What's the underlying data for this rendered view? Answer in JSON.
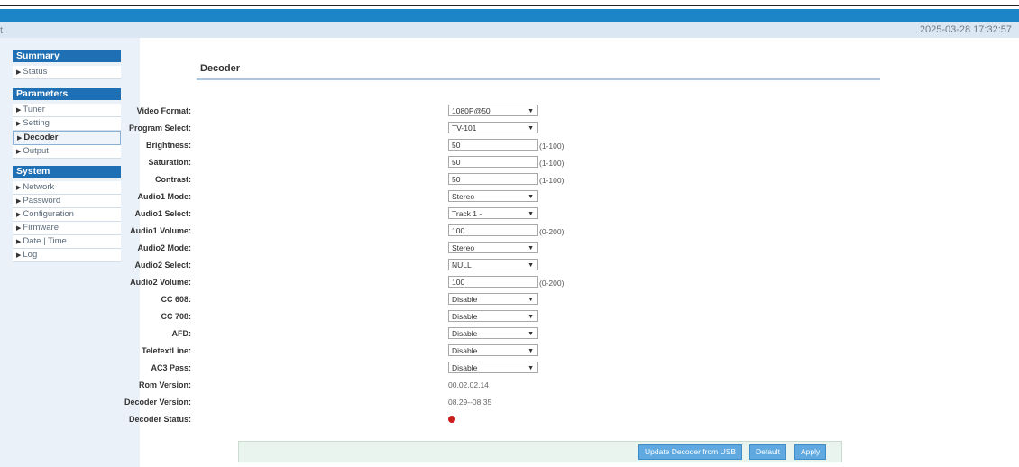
{
  "header": {
    "left_mark": "t",
    "datetime": "2025-03-28 17:32:57"
  },
  "sidebar": {
    "sections": [
      {
        "title": "Summary",
        "items": [
          "Status"
        ]
      },
      {
        "title": "Parameters",
        "items": [
          "Tuner",
          "Setting",
          "Decoder",
          "Output"
        ],
        "active": "Decoder"
      },
      {
        "title": "System",
        "items": [
          "Network",
          "Password",
          "Configuration",
          "Firmware",
          "Date | Time",
          "Log"
        ]
      }
    ]
  },
  "page": {
    "title": "Decoder"
  },
  "form": {
    "video_format": {
      "label": "Video Format:",
      "value": "1080P@50"
    },
    "program_select": {
      "label": "Program Select:",
      "value": "TV-101"
    },
    "brightness": {
      "label": "Brightness:",
      "value": "50",
      "range": "(1-100)"
    },
    "saturation": {
      "label": "Saturation:",
      "value": "50",
      "range": "(1-100)"
    },
    "contrast": {
      "label": "Contrast:",
      "value": "50",
      "range": "(1-100)"
    },
    "audio1_mode": {
      "label": "Audio1 Mode:",
      "value": "Stereo"
    },
    "audio1_select": {
      "label": "Audio1 Select:",
      "value": "Track 1 -"
    },
    "audio1_volume": {
      "label": "Audio1 Volume:",
      "value": "100",
      "range": "(0-200)"
    },
    "audio2_mode": {
      "label": "Audio2 Mode:",
      "value": "Stereo"
    },
    "audio2_select": {
      "label": "Audio2 Select:",
      "value": "NULL"
    },
    "audio2_volume": {
      "label": "Audio2 Volume:",
      "value": "100",
      "range": "(0-200)"
    },
    "cc608": {
      "label": "CC 608:",
      "value": "Disable"
    },
    "cc708": {
      "label": "CC 708:",
      "value": "Disable"
    },
    "afd": {
      "label": "AFD:",
      "value": "Disable"
    },
    "teletext_line": {
      "label": "TeletextLine:",
      "value": "Disable"
    },
    "ac3_pass": {
      "label": "AC3 Pass:",
      "value": "Disable"
    },
    "rom_version": {
      "label": "Rom Version:",
      "value": "00.02.02.14"
    },
    "decoder_version": {
      "label": "Decoder Version:",
      "value": "08.29--08.35"
    },
    "decoder_status": {
      "label": "Decoder Status:",
      "color": "#cc1b1b"
    }
  },
  "footer": {
    "update_label": "Update Decoder from USB",
    "default_label": "Default",
    "apply_label": "Apply"
  }
}
